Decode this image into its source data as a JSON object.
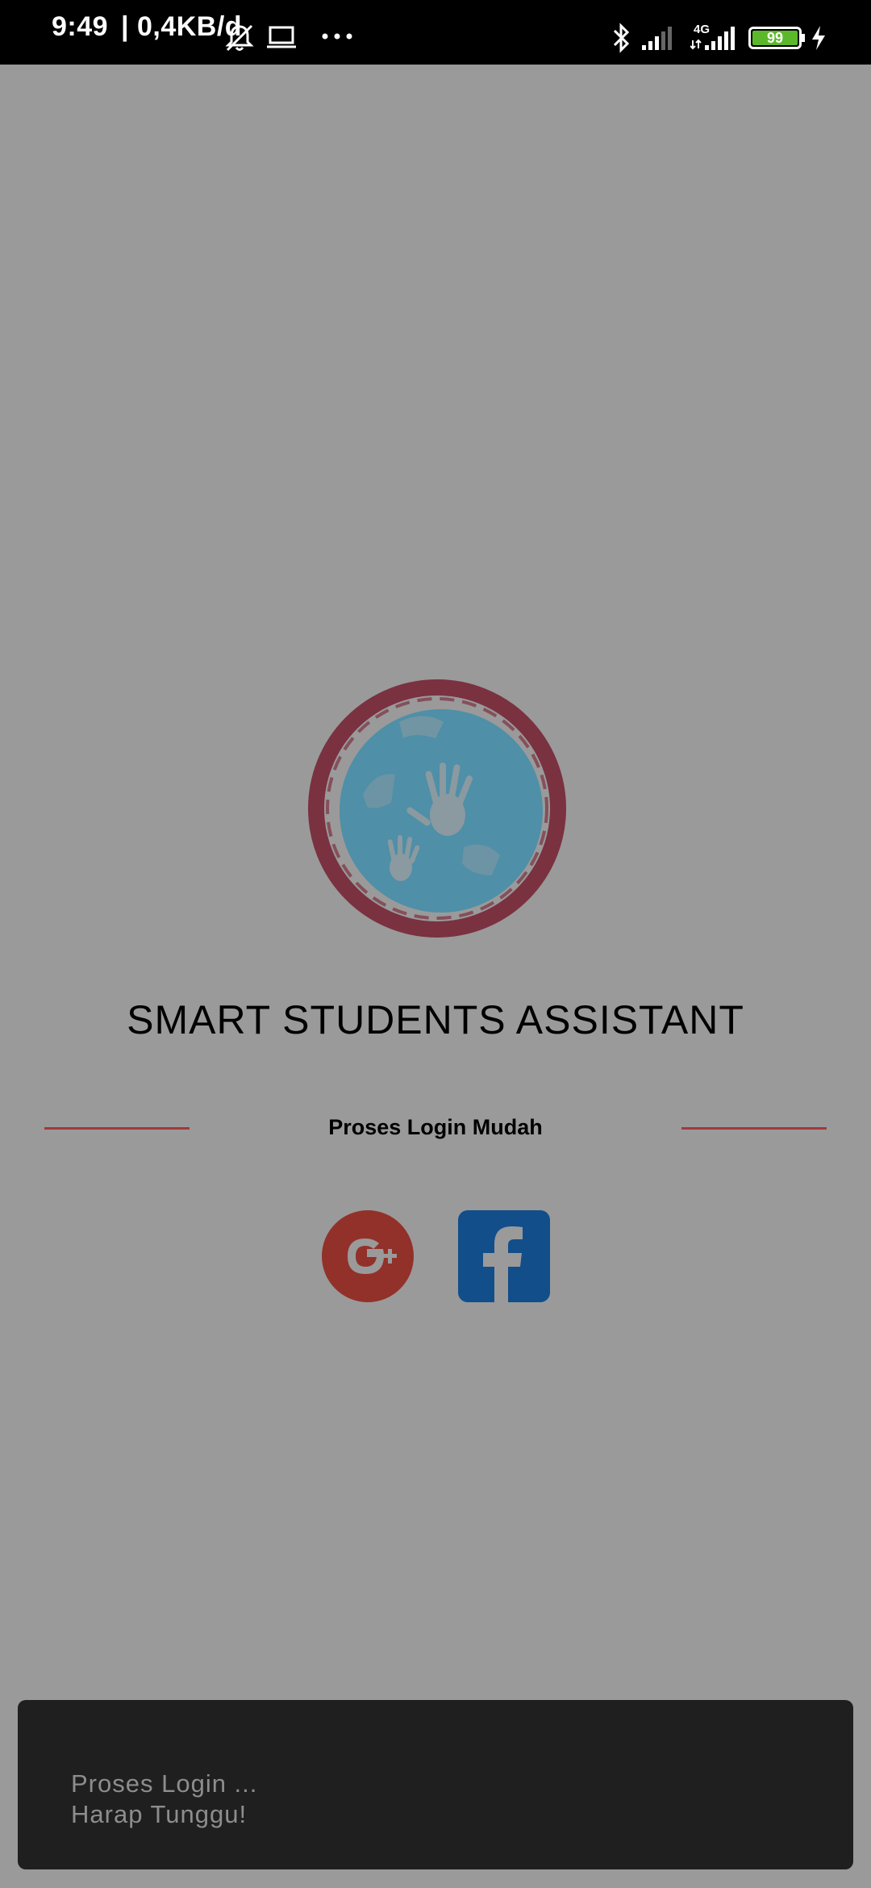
{
  "status_bar": {
    "time": "9:49",
    "data_rate": "| 0,4KB/d",
    "network_type": "4G",
    "battery": "99",
    "icons": [
      "alarm-off-icon",
      "laptop-icon",
      "more-dots-icon",
      "bluetooth-icon",
      "signal-icon",
      "signal-4g-icon",
      "battery-icon",
      "charging-icon"
    ]
  },
  "app": {
    "title": "SMART STUDENTS ASSISTANT",
    "divider_label": "Proses Login Mudah"
  },
  "login_buttons": {
    "google_icon": "google-plus-icon",
    "facebook_icon": "facebook-icon"
  },
  "toast": {
    "line1": "Proses Login ...",
    "line2": "Harap Tunggu!"
  },
  "colors": {
    "background": "#9a9a9a",
    "divider": "#a23a3a",
    "google": "#923129",
    "facebook": "#124e8a",
    "toast_bg": "#1f1f1f",
    "logo_ring": "#7a3140",
    "logo_globe": "#4f8fa8"
  }
}
